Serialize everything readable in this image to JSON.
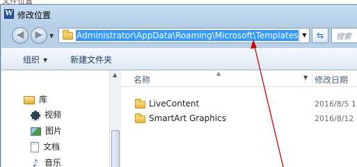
{
  "background": {
    "partial_text": "文件位置"
  },
  "window": {
    "title": "修改位置",
    "app_icon_letter": "W"
  },
  "navigation": {
    "back_icon": "back-arrow-icon",
    "forward_icon": "forward-arrow-icon",
    "address_path": "Administrator\\AppData\\Roaming\\Microsoft\\Templates",
    "refresh_icon": "refresh-icon",
    "search_placeholder": "搜索"
  },
  "toolbar": {
    "organize_label": "组织",
    "new_folder_label": "新建文件夹"
  },
  "nav_pane": {
    "items": [
      {
        "label": "库",
        "icon": "library-icon"
      },
      {
        "label": "视频",
        "icon": "video-icon"
      },
      {
        "label": "图片",
        "icon": "pictures-icon"
      },
      {
        "label": "文档",
        "icon": "documents-icon"
      },
      {
        "label": "音乐",
        "icon": "music-icon"
      }
    ]
  },
  "file_list": {
    "columns": {
      "name": "名称",
      "date_modified": "修改日期"
    },
    "rows": [
      {
        "name": "LiveContent",
        "date": "2016/8/5 1"
      },
      {
        "name": "SmartArt Graphics",
        "date": "2016/8/12"
      }
    ]
  },
  "colors": {
    "selection_highlight": "#3399ff",
    "annotation_arrow": "#cc0000",
    "chrome_blue": "#c7dcf0"
  }
}
